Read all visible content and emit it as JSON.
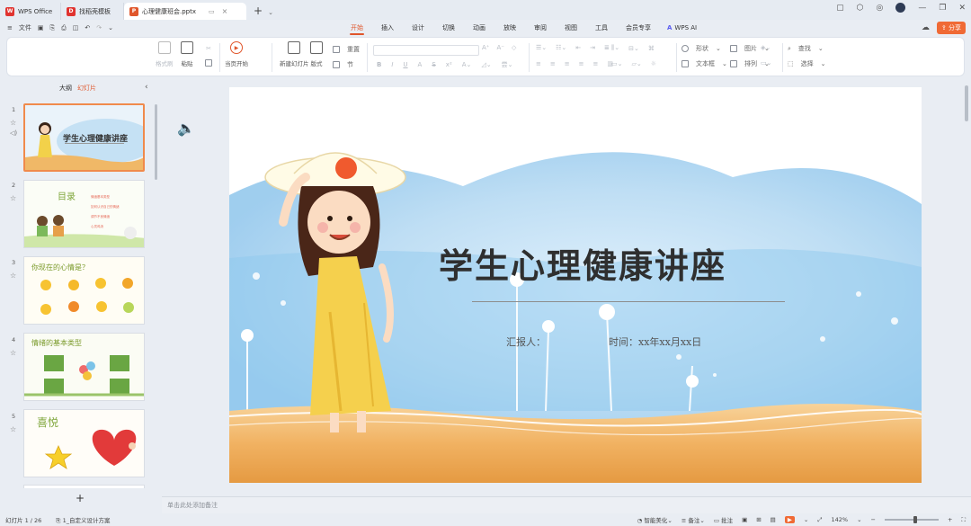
{
  "titlebar": {
    "tabs": [
      {
        "label": "WPS Office",
        "logo": "W",
        "logo_color": "#e0332f"
      },
      {
        "label": "找稻壳模板",
        "logo": "D",
        "logo_color": "#e0332f"
      },
      {
        "label": "心理健康班会.pptx",
        "logo": "P",
        "logo_color": "#e0562b"
      }
    ],
    "new_tab": "+"
  },
  "menu": {
    "file_label": "文件",
    "tabs": [
      "开始",
      "插入",
      "设计",
      "切换",
      "动画",
      "放映",
      "审阅",
      "视图",
      "工具",
      "会员专享"
    ],
    "active_tab": "开始",
    "wps_ai": "WPS AI",
    "share": "分享"
  },
  "ribbon": {
    "format_painter": "格式刷",
    "paste": "粘贴",
    "start_from_current": "当页开始",
    "new_slide": "新建幻灯片",
    "layout": "版式",
    "reset": "重置",
    "section": "节",
    "shape": "形状",
    "image": "图片",
    "textbox": "文本框",
    "arrange": "排列",
    "find": "查找",
    "select": "选择"
  },
  "panel": {
    "outline_tab": "大纲",
    "slides_tab": "幻灯片",
    "add_slide": "+",
    "slides": [
      {
        "num": "1",
        "title": "学生心理健康讲座"
      },
      {
        "num": "2",
        "title": "目录",
        "items": [
          "情绪基本类型",
          "如何认识自己的情绪",
          "调节不良情绪",
          "心灵鸡汤"
        ]
      },
      {
        "num": "3",
        "title": "你现在的心情是？"
      },
      {
        "num": "4",
        "title": "情绪的基本类型"
      },
      {
        "num": "5",
        "title": "喜悦"
      }
    ]
  },
  "slide": {
    "title": "学生心理健康讲座",
    "reporter": "汇报人：",
    "time": "时间：xx年xx月xx日"
  },
  "notes_placeholder": "单击此处添加备注",
  "status": {
    "slide_counter": "幻灯片 1 / 26",
    "theme": "1_自定义设计方案",
    "smart_beautify": "智能美化",
    "notes": "备注",
    "comments": "批注",
    "zoom": "142%"
  },
  "colors": {
    "accent": "#e0562b",
    "share_bg": "#f06a35"
  }
}
